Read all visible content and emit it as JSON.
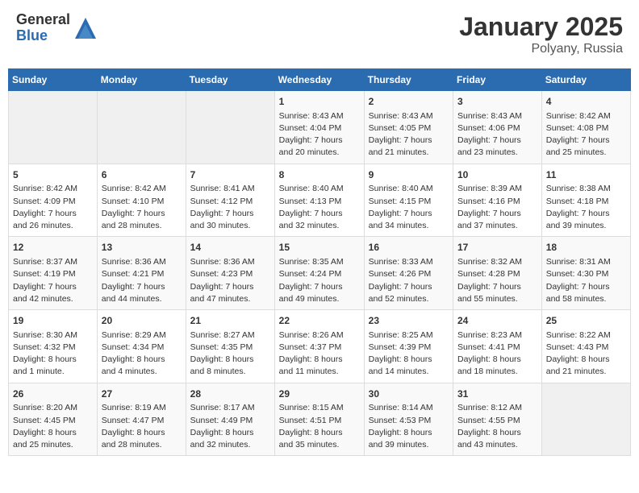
{
  "logo": {
    "general": "General",
    "blue": "Blue"
  },
  "header": {
    "month": "January 2025",
    "location": "Polyany, Russia"
  },
  "weekdays": [
    "Sunday",
    "Monday",
    "Tuesday",
    "Wednesday",
    "Thursday",
    "Friday",
    "Saturday"
  ],
  "weeks": [
    [
      {
        "day": "",
        "info": ""
      },
      {
        "day": "",
        "info": ""
      },
      {
        "day": "",
        "info": ""
      },
      {
        "day": "1",
        "info": "Sunrise: 8:43 AM\nSunset: 4:04 PM\nDaylight: 7 hours\nand 20 minutes."
      },
      {
        "day": "2",
        "info": "Sunrise: 8:43 AM\nSunset: 4:05 PM\nDaylight: 7 hours\nand 21 minutes."
      },
      {
        "day": "3",
        "info": "Sunrise: 8:43 AM\nSunset: 4:06 PM\nDaylight: 7 hours\nand 23 minutes."
      },
      {
        "day": "4",
        "info": "Sunrise: 8:42 AM\nSunset: 4:08 PM\nDaylight: 7 hours\nand 25 minutes."
      }
    ],
    [
      {
        "day": "5",
        "info": "Sunrise: 8:42 AM\nSunset: 4:09 PM\nDaylight: 7 hours\nand 26 minutes."
      },
      {
        "day": "6",
        "info": "Sunrise: 8:42 AM\nSunset: 4:10 PM\nDaylight: 7 hours\nand 28 minutes."
      },
      {
        "day": "7",
        "info": "Sunrise: 8:41 AM\nSunset: 4:12 PM\nDaylight: 7 hours\nand 30 minutes."
      },
      {
        "day": "8",
        "info": "Sunrise: 8:40 AM\nSunset: 4:13 PM\nDaylight: 7 hours\nand 32 minutes."
      },
      {
        "day": "9",
        "info": "Sunrise: 8:40 AM\nSunset: 4:15 PM\nDaylight: 7 hours\nand 34 minutes."
      },
      {
        "day": "10",
        "info": "Sunrise: 8:39 AM\nSunset: 4:16 PM\nDaylight: 7 hours\nand 37 minutes."
      },
      {
        "day": "11",
        "info": "Sunrise: 8:38 AM\nSunset: 4:18 PM\nDaylight: 7 hours\nand 39 minutes."
      }
    ],
    [
      {
        "day": "12",
        "info": "Sunrise: 8:37 AM\nSunset: 4:19 PM\nDaylight: 7 hours\nand 42 minutes."
      },
      {
        "day": "13",
        "info": "Sunrise: 8:36 AM\nSunset: 4:21 PM\nDaylight: 7 hours\nand 44 minutes."
      },
      {
        "day": "14",
        "info": "Sunrise: 8:36 AM\nSunset: 4:23 PM\nDaylight: 7 hours\nand 47 minutes."
      },
      {
        "day": "15",
        "info": "Sunrise: 8:35 AM\nSunset: 4:24 PM\nDaylight: 7 hours\nand 49 minutes."
      },
      {
        "day": "16",
        "info": "Sunrise: 8:33 AM\nSunset: 4:26 PM\nDaylight: 7 hours\nand 52 minutes."
      },
      {
        "day": "17",
        "info": "Sunrise: 8:32 AM\nSunset: 4:28 PM\nDaylight: 7 hours\nand 55 minutes."
      },
      {
        "day": "18",
        "info": "Sunrise: 8:31 AM\nSunset: 4:30 PM\nDaylight: 7 hours\nand 58 minutes."
      }
    ],
    [
      {
        "day": "19",
        "info": "Sunrise: 8:30 AM\nSunset: 4:32 PM\nDaylight: 8 hours\nand 1 minute."
      },
      {
        "day": "20",
        "info": "Sunrise: 8:29 AM\nSunset: 4:34 PM\nDaylight: 8 hours\nand 4 minutes."
      },
      {
        "day": "21",
        "info": "Sunrise: 8:27 AM\nSunset: 4:35 PM\nDaylight: 8 hours\nand 8 minutes."
      },
      {
        "day": "22",
        "info": "Sunrise: 8:26 AM\nSunset: 4:37 PM\nDaylight: 8 hours\nand 11 minutes."
      },
      {
        "day": "23",
        "info": "Sunrise: 8:25 AM\nSunset: 4:39 PM\nDaylight: 8 hours\nand 14 minutes."
      },
      {
        "day": "24",
        "info": "Sunrise: 8:23 AM\nSunset: 4:41 PM\nDaylight: 8 hours\nand 18 minutes."
      },
      {
        "day": "25",
        "info": "Sunrise: 8:22 AM\nSunset: 4:43 PM\nDaylight: 8 hours\nand 21 minutes."
      }
    ],
    [
      {
        "day": "26",
        "info": "Sunrise: 8:20 AM\nSunset: 4:45 PM\nDaylight: 8 hours\nand 25 minutes."
      },
      {
        "day": "27",
        "info": "Sunrise: 8:19 AM\nSunset: 4:47 PM\nDaylight: 8 hours\nand 28 minutes."
      },
      {
        "day": "28",
        "info": "Sunrise: 8:17 AM\nSunset: 4:49 PM\nDaylight: 8 hours\nand 32 minutes."
      },
      {
        "day": "29",
        "info": "Sunrise: 8:15 AM\nSunset: 4:51 PM\nDaylight: 8 hours\nand 35 minutes."
      },
      {
        "day": "30",
        "info": "Sunrise: 8:14 AM\nSunset: 4:53 PM\nDaylight: 8 hours\nand 39 minutes."
      },
      {
        "day": "31",
        "info": "Sunrise: 8:12 AM\nSunset: 4:55 PM\nDaylight: 8 hours\nand 43 minutes."
      },
      {
        "day": "",
        "info": ""
      }
    ]
  ]
}
